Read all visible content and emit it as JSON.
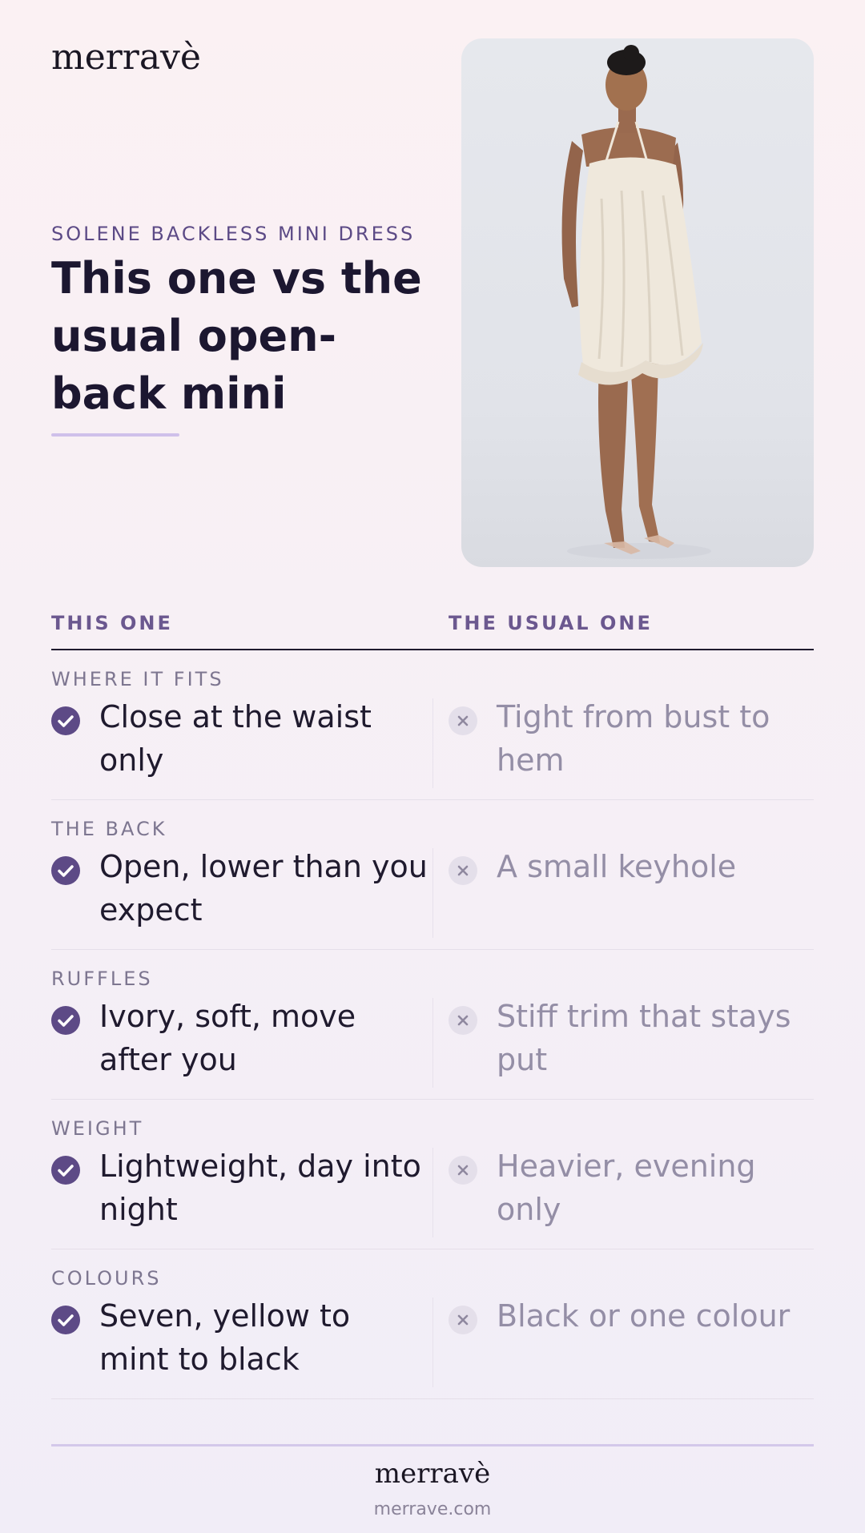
{
  "brand": {
    "logo": "merravè"
  },
  "hero": {
    "eyebrow": "SOLENE BACKLESS MINI DRESS",
    "headline": "This one vs the usual open-back mini"
  },
  "comparison": {
    "left_header": "THIS ONE",
    "right_header": "THE USUAL ONE",
    "rows": [
      {
        "label": "WHERE IT FITS",
        "this_one": "Close at the waist only",
        "usual": "Tight from bust to hem"
      },
      {
        "label": "THE BACK",
        "this_one": "Open, lower than you expect",
        "usual": "A small keyhole"
      },
      {
        "label": "RUFFLES",
        "this_one": "Ivory, soft, move after you",
        "usual": "Stiff trim that stays put"
      },
      {
        "label": "WEIGHT",
        "this_one": "Lightweight, day into night",
        "usual": "Heavier, evening only"
      },
      {
        "label": "COLOURS",
        "this_one": "Seven, yellow to mint to black",
        "usual": "Black or one colour"
      }
    ]
  },
  "footer": {
    "logo": "merravè",
    "url": "merrave.com"
  },
  "colors": {
    "accent": "#5d4a86",
    "muted": "#948ea6",
    "text": "#1f1a2e"
  },
  "icons": {
    "positive": "check-circle-icon",
    "negative": "x-circle-icon"
  }
}
